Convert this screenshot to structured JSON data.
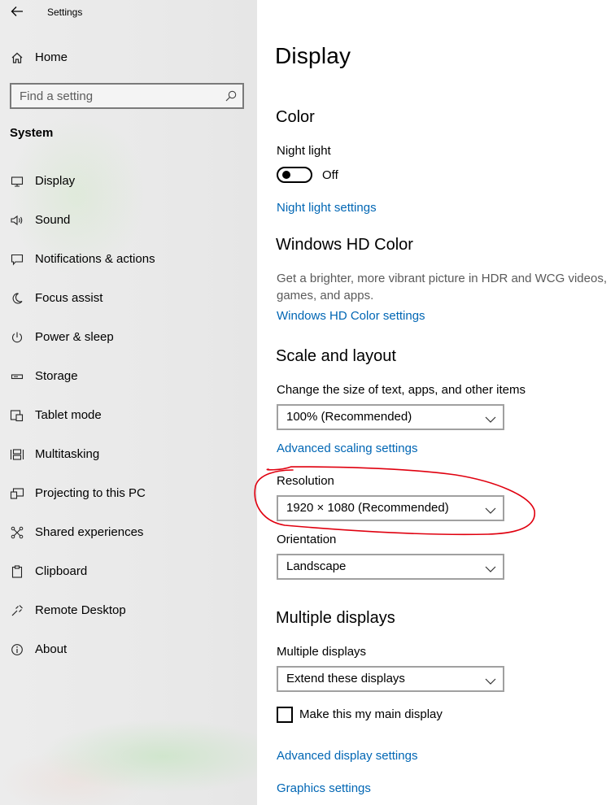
{
  "window": {
    "title": "Settings",
    "back_icon": "back-arrow-icon"
  },
  "sidebar": {
    "home": {
      "label": "Home",
      "icon": "home-icon"
    },
    "search": {
      "placeholder": "Find a setting",
      "icon": "search-icon"
    },
    "section": "System",
    "items": [
      {
        "label": "Display",
        "icon": "monitor-icon"
      },
      {
        "label": "Sound",
        "icon": "speaker-icon"
      },
      {
        "label": "Notifications & actions",
        "icon": "message-icon"
      },
      {
        "label": "Focus assist",
        "icon": "moon-icon"
      },
      {
        "label": "Power & sleep",
        "icon": "power-icon"
      },
      {
        "label": "Storage",
        "icon": "drive-icon"
      },
      {
        "label": "Tablet mode",
        "icon": "tablet-icon"
      },
      {
        "label": "Multitasking",
        "icon": "multitasking-icon"
      },
      {
        "label": "Projecting to this PC",
        "icon": "project-icon"
      },
      {
        "label": "Shared experiences",
        "icon": "shared-icon"
      },
      {
        "label": "Clipboard",
        "icon": "clipboard-icon"
      },
      {
        "label": "Remote Desktop",
        "icon": "remote-icon"
      },
      {
        "label": "About",
        "icon": "info-icon"
      }
    ]
  },
  "main": {
    "title": "Display",
    "color": {
      "heading": "Color",
      "night_light_label": "Night light",
      "night_light_state": "Off",
      "night_light_on": false,
      "night_light_link": "Night light settings"
    },
    "hd_color": {
      "heading": "Windows HD Color",
      "description": "Get a brighter, more vibrant picture in HDR and WCG videos, games, and apps.",
      "link": "Windows HD Color settings"
    },
    "scale_layout": {
      "heading": "Scale and layout",
      "scale_label": "Change the size of text, apps, and other items",
      "scale_value": "100% (Recommended)",
      "advanced_scaling_link": "Advanced scaling settings",
      "resolution_label": "Resolution",
      "resolution_value": "1920 × 1080 (Recommended)",
      "orientation_label": "Orientation",
      "orientation_value": "Landscape"
    },
    "multiple_displays": {
      "heading": "Multiple displays",
      "label": "Multiple displays",
      "value": "Extend these displays",
      "main_display_checkbox": "Make this my main display",
      "main_display_checked": false,
      "advanced_display_link": "Advanced display settings",
      "graphics_link": "Graphics settings"
    }
  },
  "colors": {
    "accent": "#0066b4",
    "annotation": "#e0000f",
    "sidebar_bg": "#eaeaea"
  }
}
